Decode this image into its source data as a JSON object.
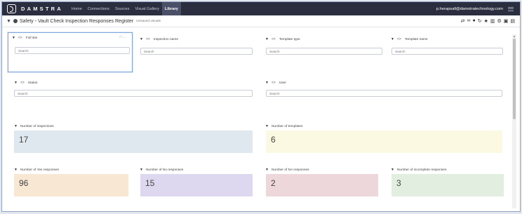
{
  "app": {
    "brand": "DAMSTRA",
    "nav": [
      {
        "label": "Home",
        "active": false
      },
      {
        "label": "Connections",
        "active": false
      },
      {
        "label": "Sources",
        "active": false
      },
      {
        "label": "Visual Gallery",
        "active": false
      },
      {
        "label": "Library",
        "active": true
      }
    ],
    "user": "p.herapsall@damstratechnology.com"
  },
  "sheet": {
    "title": "Safety - Vault Check Inspection Responses Register",
    "subtitle": "Unsaved visuals",
    "tools": [
      "share-icon",
      "link-icon",
      "info-icon",
      "refresh-icon",
      "star-icon",
      "delete-icon",
      "settings-icon",
      "save-icon",
      "export-icon"
    ]
  },
  "filters": {
    "full_site": {
      "label": "Full site",
      "placeholder": "Search"
    },
    "inspection_name": {
      "label": "Inspection name",
      "placeholder": "Search"
    },
    "template_type": {
      "label": "Template type",
      "placeholder": "Search"
    },
    "template_name": {
      "label": "Template name",
      "placeholder": "Search"
    },
    "status": {
      "label": "Status",
      "placeholder": "Search"
    },
    "user": {
      "label": "User",
      "placeholder": "Search"
    }
  },
  "metrics": {
    "inspections": {
      "label": "Number of inspections",
      "value": "17",
      "color": "#dfe7ef"
    },
    "templates": {
      "label": "Number of templates",
      "value": "6",
      "color": "#fcf9e2"
    },
    "yes": {
      "label": "Number of Yes responses",
      "value": "96",
      "color": "#f8e7d2"
    },
    "no": {
      "label": "Number of No responses",
      "value": "15",
      "color": "#ddd8ef"
    },
    "na": {
      "label": "Number of NA responses",
      "value": "2",
      "color": "#edd7da"
    },
    "incomplete": {
      "label": "Number of incomplete responses",
      "value": "3",
      "color": "#e2efe0"
    }
  }
}
